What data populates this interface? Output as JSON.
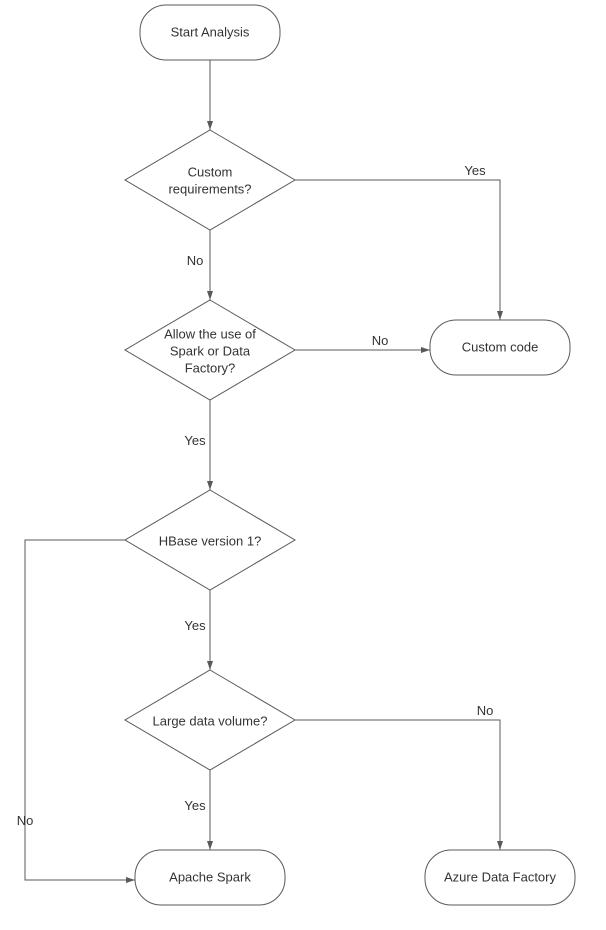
{
  "chart_data": {
    "type": "flowchart",
    "nodes": [
      {
        "id": "start",
        "type": "terminator",
        "label": "Start Analysis"
      },
      {
        "id": "custom_req",
        "type": "decision",
        "label": "Custom requirements?"
      },
      {
        "id": "allow_spark",
        "type": "decision",
        "label": "Allow the use of Spark or Data Factory?"
      },
      {
        "id": "custom_code",
        "type": "terminator",
        "label": "Custom code"
      },
      {
        "id": "hbase_v1",
        "type": "decision",
        "label": "HBase version 1?"
      },
      {
        "id": "large_data",
        "type": "decision",
        "label": "Large data volume?"
      },
      {
        "id": "apache_spark",
        "type": "terminator",
        "label": "Apache Spark"
      },
      {
        "id": "azure_df",
        "type": "terminator",
        "label": "Azure Data Factory"
      }
    ],
    "edges": [
      {
        "from": "start",
        "to": "custom_req",
        "label": ""
      },
      {
        "from": "custom_req",
        "to": "custom_code",
        "label": "Yes"
      },
      {
        "from": "custom_req",
        "to": "allow_spark",
        "label": "No"
      },
      {
        "from": "allow_spark",
        "to": "custom_code",
        "label": "No"
      },
      {
        "from": "allow_spark",
        "to": "hbase_v1",
        "label": "Yes"
      },
      {
        "from": "hbase_v1",
        "to": "apache_spark",
        "label": "No"
      },
      {
        "from": "hbase_v1",
        "to": "large_data",
        "label": "Yes"
      },
      {
        "from": "large_data",
        "to": "apache_spark",
        "label": "Yes"
      },
      {
        "from": "large_data",
        "to": "azure_df",
        "label": "No"
      }
    ]
  },
  "labels": {
    "start": "Start Analysis",
    "custom_req": "Custom requirements?",
    "allow_spark_l1": "Allow the use of",
    "allow_spark_l2": "Spark or Data",
    "allow_spark_l3": "Factory?",
    "custom_code": "Custom code",
    "hbase_v1": "HBase version 1?",
    "large_data": "Large data volume?",
    "apache_spark": "Apache Spark",
    "azure_df": "Azure Data Factory",
    "yes": "Yes",
    "no": "No"
  }
}
